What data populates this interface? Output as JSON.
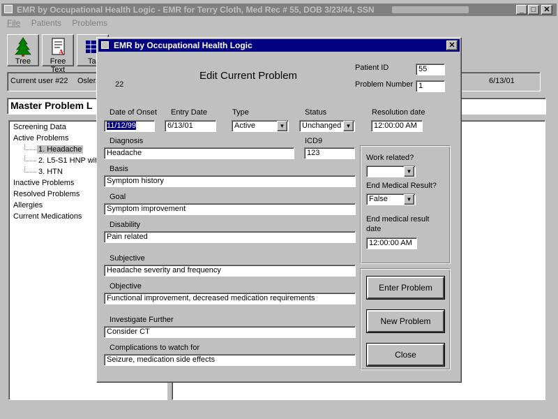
{
  "main_window": {
    "title": "EMR by Occupational Health Logic - EMR for Terry Cloth, Med Rec # 55, DOB 3/23/44, SSN",
    "menu": [
      "File",
      "Patients",
      "Problems"
    ],
    "toolbar": [
      {
        "label": "Tree",
        "icon": "tree-icon"
      },
      {
        "label": "Free Text",
        "icon": "free-text-icon"
      },
      {
        "label": "Tal",
        "icon": "table-icon"
      }
    ],
    "current_user": "Current user #22",
    "current_user_name": "Osler,",
    "date": "6/13/01",
    "panel_title": "Master Problem L",
    "tree": [
      {
        "label": "Screening Data",
        "level": 0
      },
      {
        "label": "Active Problems",
        "level": 0
      },
      {
        "label": "1. Headache",
        "level": 1,
        "selected": true
      },
      {
        "label": "2. L5-S1 HNP wit",
        "level": 1
      },
      {
        "label": "3. HTN",
        "level": 1
      },
      {
        "label": "Inactive Problems",
        "level": 0
      },
      {
        "label": "Resolved Problems",
        "level": 0
      },
      {
        "label": "Allergies",
        "level": 0
      },
      {
        "label": "Current Medications",
        "level": 0
      }
    ]
  },
  "dialog": {
    "title": "EMR by Occupational Health Logic",
    "heading": "Edit Current Problem",
    "id_value": "22",
    "patient_id_label": "Patient ID",
    "patient_id": "55",
    "problem_number_label": "Problem Number",
    "problem_number": "1",
    "date_of_onset_label": "Date of Onset",
    "date_of_onset": "11/12/99",
    "entry_date_label": "Entry Date",
    "entry_date": "6/13/01",
    "type_label": "Type",
    "type": "Active",
    "status_label": "Status",
    "status": "Unchanged",
    "resolution_date_label": "Resolution date",
    "resolution_date": "12:00:00 AM",
    "diagnosis_label": "Diagnosis",
    "diagnosis": "Headache",
    "icd9_label": "ICD9",
    "icd9": "123",
    "basis_label": "Basis",
    "basis": "Symptom history",
    "goal_label": "Goal",
    "goal": "Symptom improvement",
    "disability_label": "Disability",
    "disability": "Pain related",
    "subjective_label": "Subjective",
    "subjective": "Headache severity and frequency",
    "objective_label": "Objective",
    "objective": "Functional improvement, decreased medication requirements",
    "investigate_label": "Investigate Further",
    "investigate": "Consider CT",
    "complications_label": "Complications to watch for",
    "complications": "Seizure, medication side effects",
    "work_related_label": "Work related?",
    "work_related": "",
    "end_medical_result_label": "End Medical Result?",
    "end_medical_result": "False",
    "end_medical_date_label_1": "End medical result",
    "end_medical_date_label_2": "date",
    "end_medical_date": "12:00:00 AM",
    "buttons": {
      "enter": "Enter Problem",
      "new": "New Problem",
      "close": "Close"
    }
  },
  "colors": {
    "active_title": "#000080",
    "inactive_title": "#808080",
    "face": "#c0c0c0",
    "selection": "#000080"
  }
}
